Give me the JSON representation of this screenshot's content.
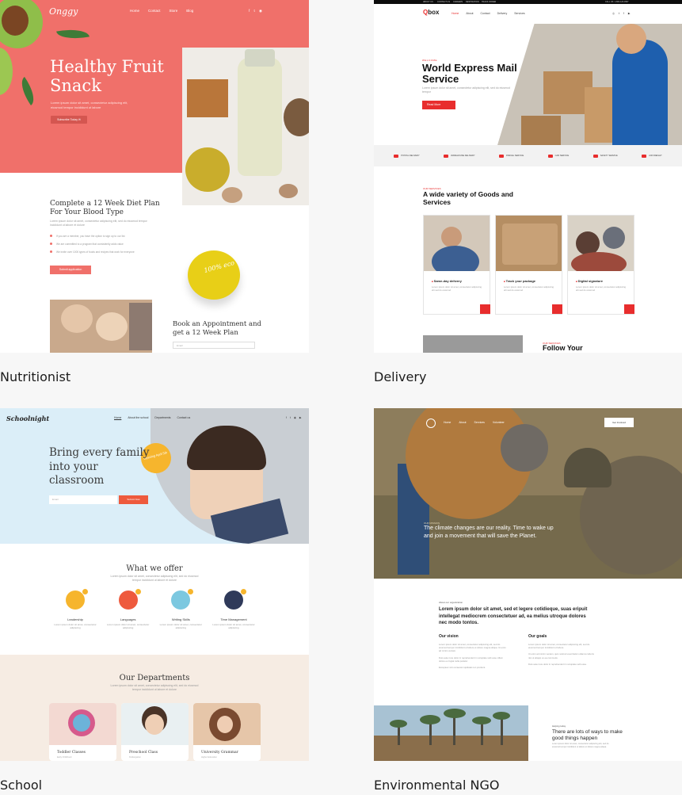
{
  "templates": [
    {
      "caption": "Nutritionist",
      "logo": "Onggy",
      "nav": [
        "Home",
        "Contact",
        "Store",
        "Blog"
      ],
      "social": "f t ◉",
      "hero_title": "Healthy Fruit Snack",
      "hero_sub": "Lorem ipsum dolor sit amet, consectetur adipiscing elit, eiusmod tempor incididunt ut labore",
      "hero_button": "Subscribe Today ✉",
      "plan_title": "Complete a 12 Week Diet Plan For Your Blood Type",
      "plan_text": "Lorem ipsum dolor sit amet, consectetur adipiscing elit, sed do eiusmod tempor incididunt ut labore et dolore",
      "plan_list": [
        "If you are a member, you have the option to sign up to our list",
        "We are committed to a program that consistently adds value",
        "We invite over 1000 types of foods and recipes that work for everyone"
      ],
      "plan_button": "Submit application",
      "fruit_label": "100% eco",
      "appointment_title": "Book an Appointment and get a 12 Week Plan",
      "appointment_placeholder": "Email"
    },
    {
      "caption": "Delivery",
      "logo_accent": "Q",
      "logo_rest": "box",
      "nav": [
        "Home",
        "About",
        "Contact",
        "Delivery",
        "Services"
      ],
      "social": "◎ t f ▶",
      "top_items": [
        "ABOUT US",
        "CONTACT US",
        "CAREERS",
        "DESTINATION",
        "TRACK ORDER"
      ],
      "top_phone": "CALL US: 1-800-123-4567",
      "hero_kicker": "WELCOME",
      "hero_title": "World Express Mail Service",
      "hero_sub": "Lorem ipsum dolor sit amet, consectetur adipiscing elit, sed do eiusmod tempor",
      "hero_button": "Read More",
      "services": [
        "POSTAL DELIVERY",
        "WAREHOUSE DELIVERY",
        "PARCEL SERVICE",
        "CAR SERVICE",
        "SAFETY SERVICE",
        "AIR FREIGHT"
      ],
      "section_kicker": "OUR SERVICES",
      "section_title": "A wide variety of Goods and Services",
      "cards": [
        {
          "title": "Same-day delivery",
          "text": "Lorem ipsum dolor sit amet, consectetur adipiscing elit sed do eiusmod"
        },
        {
          "title": "Track your package",
          "text": "Lorem ipsum dolor sit amet, consectetur adipiscing elit sed do eiusmod"
        },
        {
          "title": "Digital signature",
          "text": "Lorem ipsum dolor sit amet, consectetur adipiscing elit sed do eiusmod"
        }
      ],
      "follow_kicker": "OUR SERVICES",
      "follow_title": "Follow Your"
    },
    {
      "caption": "School",
      "logo": "Schoolnight",
      "nav": [
        "Home",
        "About the school",
        "Departments",
        "Contact us"
      ],
      "social": "f t ◉ ▶",
      "badge": "Opening April 5th",
      "hero_title": "Bring every family into your classroom",
      "input_placeholder": "Email",
      "hero_button": "Submit Now",
      "offer_title": "What we offer",
      "offer_sub": "Lorem ipsum dolor sit amet, consectetur adipiscing elit, sed do eiusmod tempor incididunt ut labore et dolore",
      "features": [
        {
          "name": "Leadership",
          "text": "Lorem ipsum dolor sit amet, consectetur adipiscing",
          "color": "#f6b52d"
        },
        {
          "name": "Languages",
          "text": "Lorem ipsum dolor sit amet, consectetur adipiscing",
          "color": "#ee5a3d"
        },
        {
          "name": "Writing Skills",
          "text": "Lorem ipsum dolor sit amet, consectetur adipiscing",
          "color": "#7cc8e0"
        },
        {
          "name": "Time Management",
          "text": "Lorem ipsum dolor sit amet, consectetur adipiscing",
          "color": "#2f3a5a"
        }
      ],
      "dept_title": "Our Departments",
      "dept_sub": "Lorem ipsum dolor sit amet, consectetur adipiscing elit, sed do eiusmod tempor incididunt ut labore et dolore",
      "departments": [
        {
          "name": "Toddler Classes",
          "sub": "Early Childhood"
        },
        {
          "name": "Preschool Class",
          "sub": "Kindergarten"
        },
        {
          "name": "University Grammar",
          "sub": "Higher Education"
        }
      ]
    },
    {
      "caption": "Environmental NGO",
      "nav": [
        "Home",
        "About",
        "Services",
        "Volunteer"
      ],
      "hero_button": "Get Involved",
      "hero_tag": "OUR MISSION",
      "hero_quote": "The climate changes are our reality. Time to wake up and join a movement that will save the Planet.",
      "about_kicker": "About our organization",
      "about_lead": "Lorem ipsum dolor sit amet, sed et legere cotidieque, suas eripuit intellegat mediocrem consectetuer ad, ea melius utroque dolores nec modo tontos.",
      "vision_title": "Our vision",
      "vision_text": [
        "Lorem ipsum dolor sit amet, consectetur adipiscing elit, sed do eiusmod tempor incididunt ut labore et dolore magna aliqua. Ut enim ad minim veniam.",
        "Duis aute irure dolor in reprehenderit in voluptate velit esse cillum dolore eu fugiat nulla pariatur.",
        "Excepteur sint occaecat cupidatat non proident."
      ],
      "goals_title": "Our goals",
      "goals_text": [
        "Lorem ipsum dolor sit amet, consectetur adipiscing elit, sed do eiusmod tempor incididunt ut labore.",
        "Ut enim ad minim veniam, quis nostrud exercitation ullamco laboris nisi ut aliquip ex ea commodo.",
        "Duis aute irure dolor in reprehenderit in voluptate velit esse."
      ],
      "help_kicker": "Helping today",
      "help_title": "There are lots of ways to make good things happen",
      "help_text": "Lorem ipsum dolor sit amet, consectetur adipiscing elit, sed do eiusmod tempor incididunt ut labore et dolore magna aliqua."
    }
  ],
  "colors": {
    "nutritionist_accent": "#f0706a",
    "delivery_accent": "#e82d2d",
    "school_accent": "#ee5a3d",
    "school_hero": "#dbeef8",
    "school_departments_bg": "#f6ece3",
    "page_bg": "#f7f7f7"
  }
}
